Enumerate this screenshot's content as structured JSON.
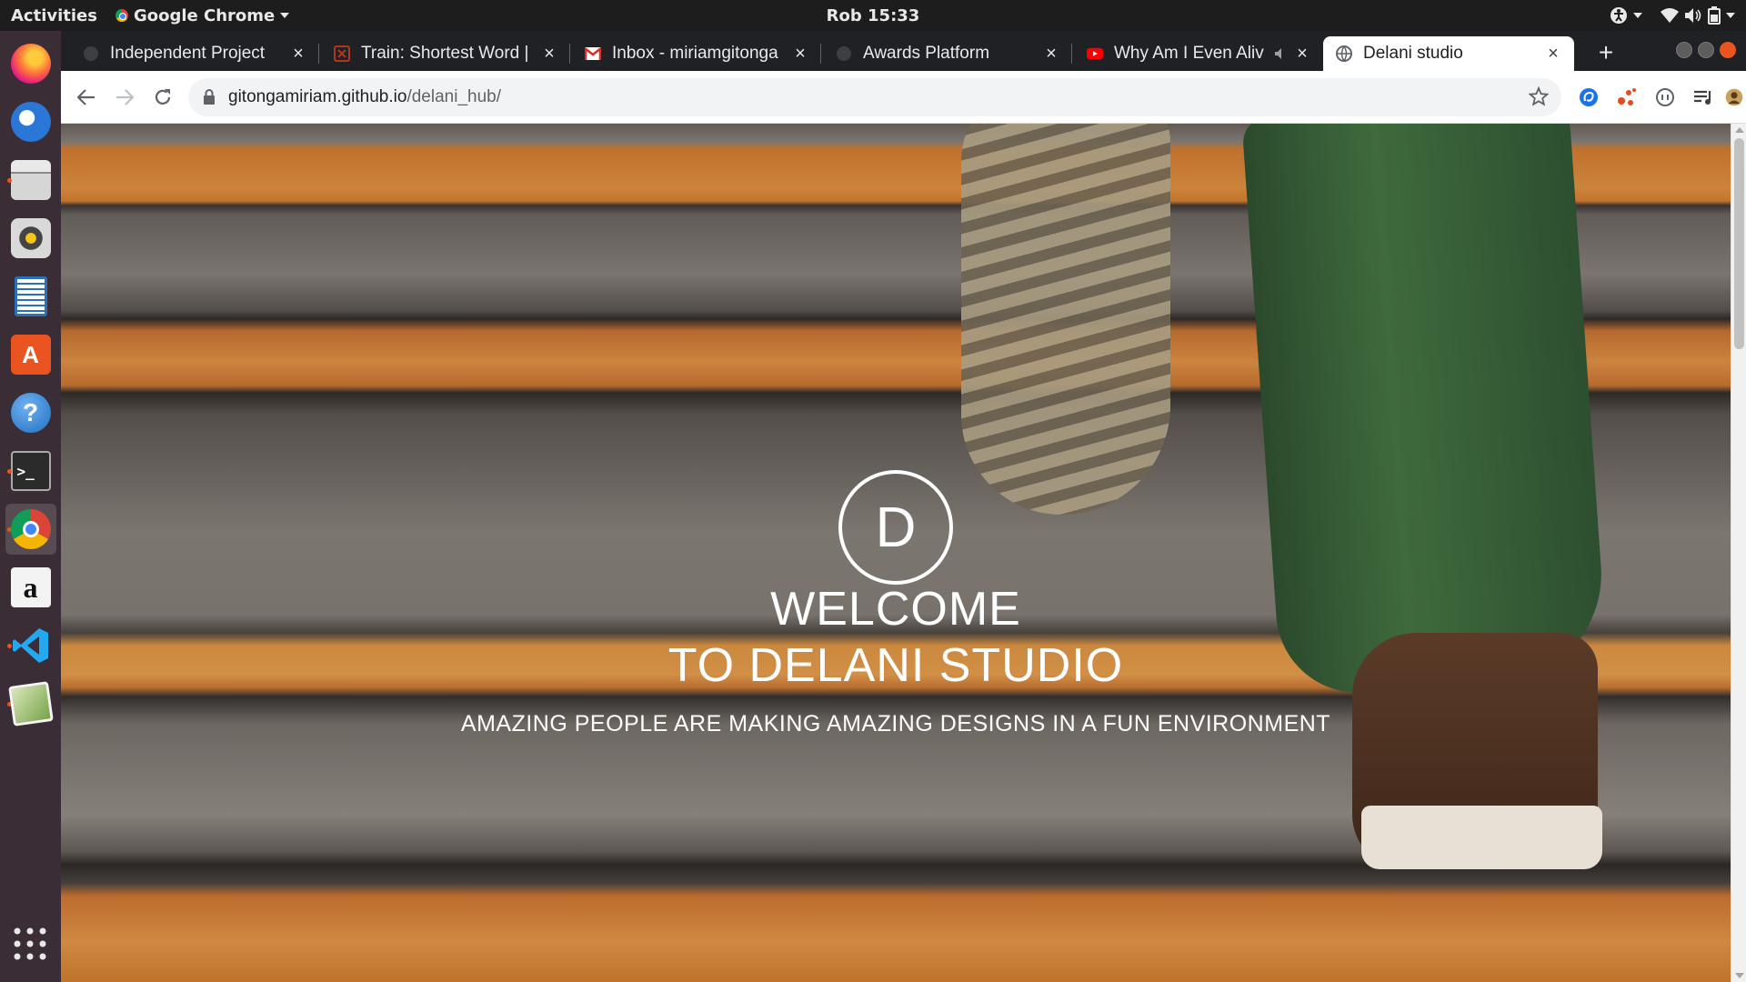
{
  "topbar": {
    "activities": "Activities",
    "app_name": "Google Chrome",
    "clock": "Rob 15:33"
  },
  "dock": {
    "items": [
      {
        "name": "firefox",
        "icon": "firefox-icon"
      },
      {
        "name": "thunderbird",
        "icon": "thunderbird-icon"
      },
      {
        "name": "files",
        "icon": "files-icon"
      },
      {
        "name": "rhythmbox",
        "icon": "speaker-icon"
      },
      {
        "name": "libreoffice-writer",
        "icon": "document-icon"
      },
      {
        "name": "software",
        "icon": "software-center-icon"
      },
      {
        "name": "help",
        "icon": "help-icon",
        "glyph": "?"
      },
      {
        "name": "terminal",
        "icon": "terminal-icon",
        "glyph": ">_"
      },
      {
        "name": "chrome",
        "icon": "chrome-icon",
        "active": true
      },
      {
        "name": "amazon",
        "icon": "amazon-icon",
        "glyph": "a"
      },
      {
        "name": "vscode",
        "icon": "vscode-icon"
      },
      {
        "name": "image-viewer",
        "icon": "image-viewer-icon"
      }
    ]
  },
  "browser": {
    "tabs": [
      {
        "title": "Independent Project",
        "favicon": "github-icon"
      },
      {
        "title": "Train: Shortest Word |",
        "favicon": "codewars-icon"
      },
      {
        "title": "Inbox - miriamgitonga",
        "favicon": "gmail-icon"
      },
      {
        "title": "Awards Platform",
        "favicon": "github-icon"
      },
      {
        "title": "Why Am I Even Aliv",
        "favicon": "youtube-icon"
      },
      {
        "title": "Delani studio",
        "favicon": "globe-icon",
        "active": true
      }
    ],
    "close_glyph": "×",
    "newtab_glyph": "+",
    "url_host": "gitongamiriam.github.io",
    "url_path": "/delani_hub/"
  },
  "page": {
    "logo_letter": "D",
    "welcome_line1": "WELCOME",
    "welcome_line2": "TO DELANI STUDIO",
    "tagline": "AMAZING PEOPLE ARE MAKING AMAZING DESIGNS IN A FUN ENVIRONMENT"
  },
  "colors": {
    "accent_orange": "#e95420",
    "stair_orange": "#f09a44",
    "chrome_dark": "#202124"
  }
}
